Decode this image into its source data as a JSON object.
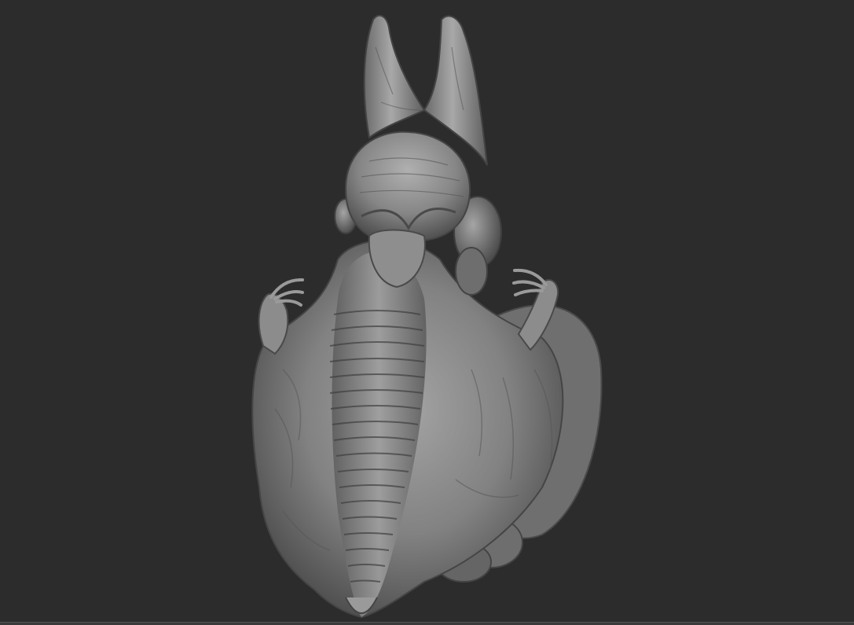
{
  "viewport": {
    "background_color": "#2c2c2c",
    "subject": "sculpted-creature-bust",
    "material_color": "#8a8a8a",
    "highlight_color": "#b8b8b8",
    "shadow_color": "#3c3c3c"
  }
}
